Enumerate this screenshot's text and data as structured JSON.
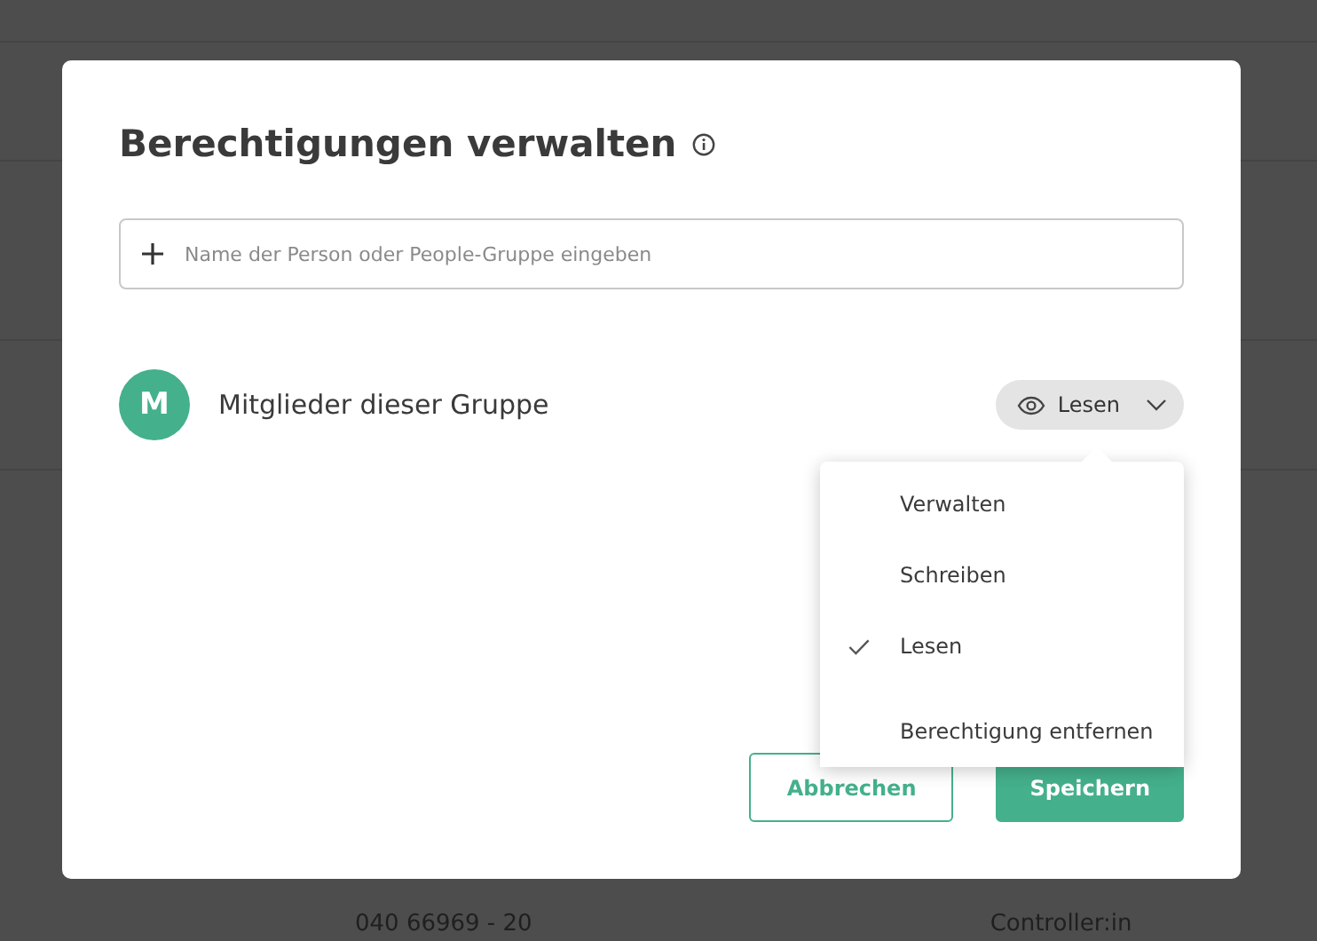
{
  "background": {
    "row_cells": [
      "040 66969 - 20",
      "Controller:in"
    ]
  },
  "dialog": {
    "title": "Berechtigungen verwalten",
    "search": {
      "placeholder": "Name der Person oder People-Gruppe eingeben"
    },
    "members": [
      {
        "initial": "M",
        "name": "Mitglieder dieser Gruppe",
        "color": "#44b08c",
        "permission": "Lesen",
        "expanded": true
      }
    ],
    "menu": [
      {
        "kind": "option",
        "label": "Verwalten",
        "selected": false
      },
      {
        "kind": "option",
        "label": "Schreiben",
        "selected": false
      },
      {
        "kind": "option",
        "label": "Lesen",
        "selected": true
      },
      {
        "kind": "action",
        "label": "Berechtigung entfernen"
      }
    ],
    "buttons": [
      {
        "kind": "secondary",
        "label": "Abbrechen"
      },
      {
        "kind": "primary",
        "label": "Speichern"
      }
    ]
  }
}
